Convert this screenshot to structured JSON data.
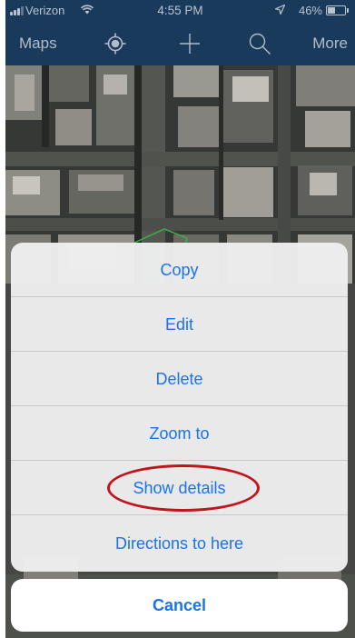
{
  "status_bar": {
    "carrier": "Verizon",
    "time": "4:55 PM",
    "battery_percent": "46%",
    "battery_level": 0.46,
    "icons": [
      "signal-bars-icon",
      "wifi-icon",
      "location-arrow-icon",
      "battery-icon"
    ]
  },
  "nav_bar": {
    "left_label": "Maps",
    "right_label": "More",
    "icons": [
      "gps-locate-icon",
      "add-icon",
      "search-icon"
    ]
  },
  "action_sheet": {
    "items": [
      {
        "label": "Copy"
      },
      {
        "label": "Edit"
      },
      {
        "label": "Delete"
      },
      {
        "label": "Zoom to"
      },
      {
        "label": "Show details",
        "highlighted": true
      },
      {
        "label": "Directions to here"
      }
    ],
    "cancel_label": "Cancel"
  },
  "colors": {
    "nav_background": "#1d3f63",
    "action_text": "#1a73e8",
    "highlight": "#c0151c",
    "sheet_background": "#eeeef0"
  }
}
